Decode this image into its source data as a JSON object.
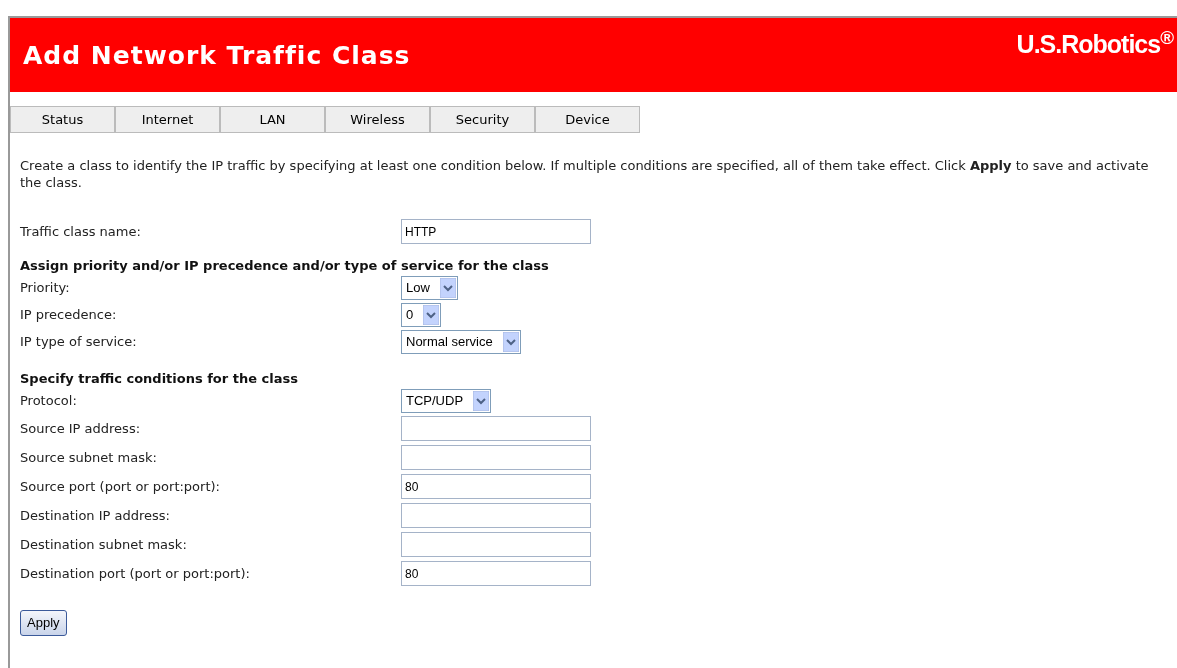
{
  "header": {
    "title": "Add Network Traffic Class",
    "logo": "U.S.Robotics$^{®}$"
  },
  "tabs": [
    {
      "label": "Status",
      "selected": false
    },
    {
      "label": "Internet",
      "selected": false
    },
    {
      "label": "LAN",
      "selected": false
    },
    {
      "label": "Wireless",
      "selected": false
    },
    {
      "label": "Security",
      "selected": false
    },
    {
      "label": "Device",
      "selected": false
    }
  ],
  "intro": "Create a class to identify the IP traffic by specifying at least one condition below. If multiple conditions are specified, all of them take effect. Click **Apply** to save and activate the class.",
  "name_field": {
    "label": "Traffic class name:",
    "value": "HTTP"
  },
  "sections": [
    {
      "heading": "Assign priority and/or IP precedence and/or type of service for the class",
      "fields": [
        {
          "kind": "select",
          "label": "Priority:",
          "value": "Low"
        },
        {
          "kind": "select",
          "label": "IP precedence:",
          "value": "0"
        },
        {
          "kind": "select",
          "label": "IP type of service:",
          "value": "Normal service"
        }
      ]
    },
    {
      "heading": "Specify traffic conditions for the class",
      "fields": [
        {
          "kind": "select",
          "label": "Protocol:",
          "value": "TCP/UDP"
        },
        {
          "kind": "text",
          "label": "Source IP address:"
        },
        {
          "kind": "text",
          "label": "Source subnet mask:"
        },
        {
          "kind": "text",
          "label": "Source port (port or port:port):",
          "value": "80"
        },
        {
          "kind": "text",
          "label": "Destination IP address:"
        },
        {
          "kind": "text",
          "label": "Destination subnet mask:"
        },
        {
          "kind": "text",
          "label": "Destination port (port or port:port):",
          "value": "80"
        }
      ]
    }
  ],
  "apply_button": "Apply"
}
